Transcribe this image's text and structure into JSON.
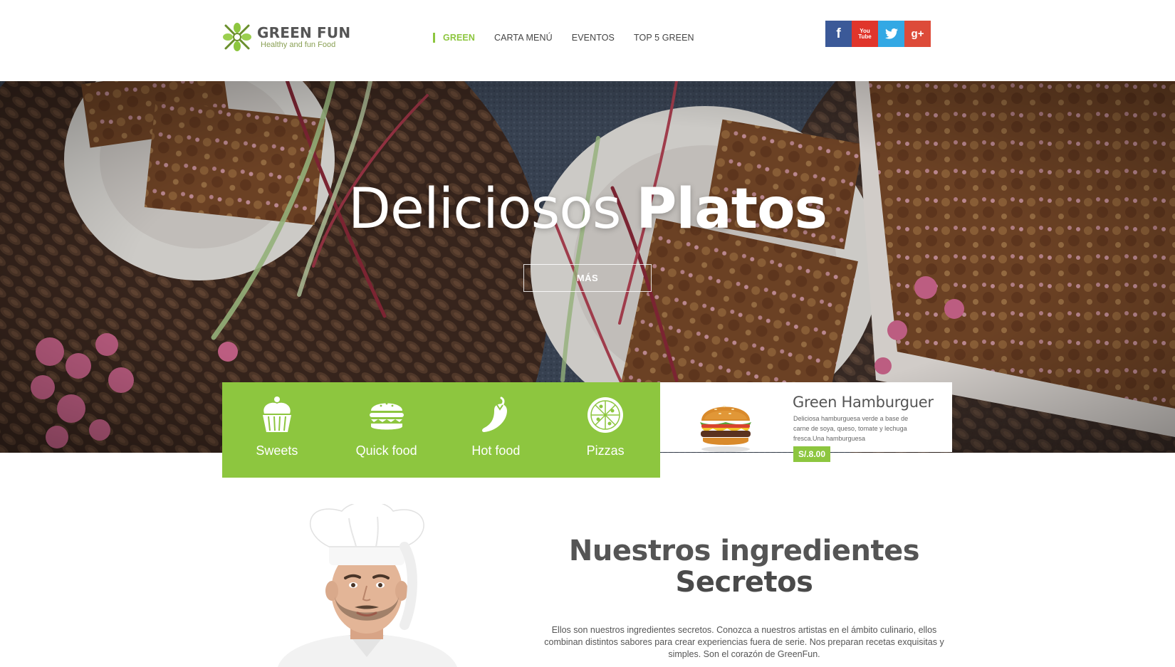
{
  "logo": {
    "name": "GREEN FUN",
    "tagline": "Healthy and fun Food"
  },
  "nav": {
    "items": [
      {
        "label": "GREEN",
        "active": true
      },
      {
        "label": "CARTA MENÚ",
        "active": false
      },
      {
        "label": "EVENTOS",
        "active": false
      },
      {
        "label": "TOP 5 GREEN",
        "active": false
      }
    ]
  },
  "social": {
    "facebook": {
      "glyph": "f",
      "color": "#3b5998"
    },
    "youtube": {
      "glyph_top": "You",
      "glyph_bottom": "Tube",
      "color": "#e0352b"
    },
    "twitter": {
      "icon": "twitter-bird-icon",
      "color": "#33a8e4"
    },
    "googleplus": {
      "glyph": "g+",
      "color": "#dd4b39"
    }
  },
  "hero": {
    "title_light": "Deliciosos",
    "title_bold": "Platos",
    "button": "MÁS"
  },
  "categories": [
    {
      "label": "Sweets",
      "icon": "cupcake-icon"
    },
    {
      "label": "Quick food",
      "icon": "burger-icon"
    },
    {
      "label": "Hot food",
      "icon": "chili-pepper-icon"
    },
    {
      "label": "Pizzas",
      "icon": "pizza-icon"
    }
  ],
  "featured": {
    "title": "Green Hamburguer",
    "description": "Deliciosa hamburguesa verde a base de carne de soya, queso, tomate y lechuga fresca.Una hamburguesa",
    "price": "S/.8.00"
  },
  "ingredients": {
    "title_light": "Nuestros ingredientes",
    "title_bold": "Secretos",
    "text": "Ellos son nuestros ingredientes secretos. Conozca a nuestros artistas en el ámbito culinario, ellos combinan distintos sabores para crear experiencias fuera de serie. Nos preparan recetas exquisitas y simples. Son el corazón de GreenFun."
  },
  "colors": {
    "accent": "#8dc63f",
    "text": "#555555",
    "facebook": "#3b5998",
    "youtube": "#e0352b",
    "twitter": "#33a8e4",
    "googleplus": "#dd4b39"
  }
}
